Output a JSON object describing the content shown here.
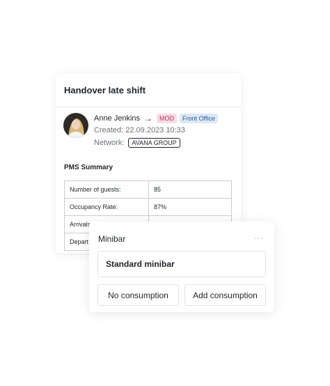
{
  "handover": {
    "title": "Handover late shift",
    "person": {
      "name": "Anne Jenkins",
      "arrow": "→",
      "role_badge": "MOD",
      "department_badge": "Front Office"
    },
    "created": "Created: 22.09.2023 10:33",
    "network_label": "Network:",
    "network_value": "AVANA GROUP",
    "pms_title": "PMS Summary",
    "pms_rows": [
      {
        "label": "Number of guests:",
        "value": "85"
      },
      {
        "label": "Occupancy Rate:",
        "value": "87%"
      },
      {
        "label": "Arrivals",
        "value": ""
      },
      {
        "label": "Depart",
        "value": ""
      }
    ]
  },
  "minibar": {
    "title": "Minibar",
    "more": "···",
    "option": "Standard minibar",
    "buttons": {
      "no_consumption": "No consumption",
      "add_consumption": "Add consumption"
    }
  },
  "colors": {
    "mod_badge_bg": "#f8dde4",
    "mod_badge_text": "#b8325a",
    "dept_badge_bg": "#dde8f7",
    "dept_badge_text": "#2c5a8a"
  }
}
